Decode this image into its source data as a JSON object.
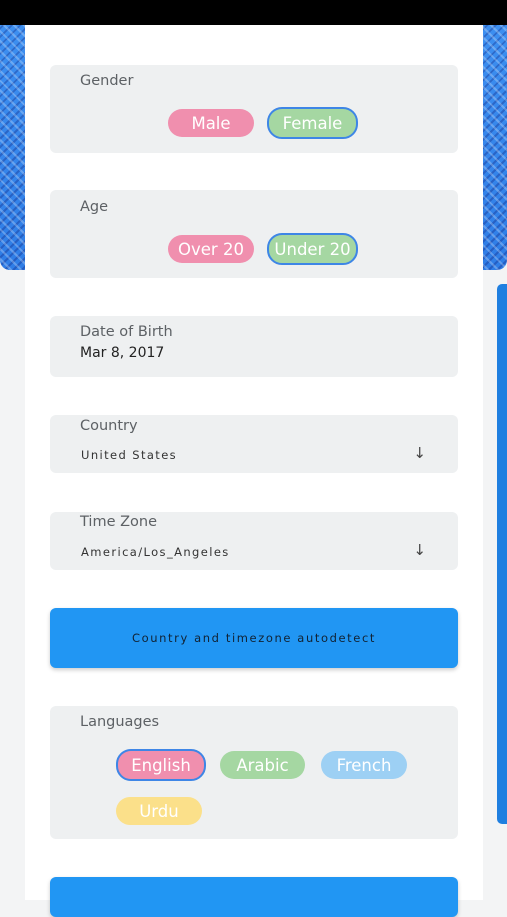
{
  "gender": {
    "label": "Gender",
    "options": [
      "Male",
      "Female"
    ]
  },
  "age": {
    "label": "Age",
    "options": [
      "Over 20",
      "Under 20"
    ]
  },
  "dob": {
    "label": "Date of Birth",
    "value": "Mar 8, 2017"
  },
  "country": {
    "label": "Country",
    "value": "United States",
    "arrow": "↓"
  },
  "timezone": {
    "label": "Time Zone",
    "value": "America/Los_Angeles",
    "arrow": "↓"
  },
  "autodetect": {
    "label": "Country and timezone autodetect"
  },
  "languages": {
    "label": "Languages",
    "options": [
      "English",
      "Arabic",
      "French",
      "Urdu"
    ]
  },
  "colors": {
    "primary": "#2196f3",
    "pink": "#f08fae",
    "green": "#a5d7a2",
    "blue": "#9dd0f4",
    "yellow": "#fbe08a",
    "selected_border": "#3e86e6"
  }
}
